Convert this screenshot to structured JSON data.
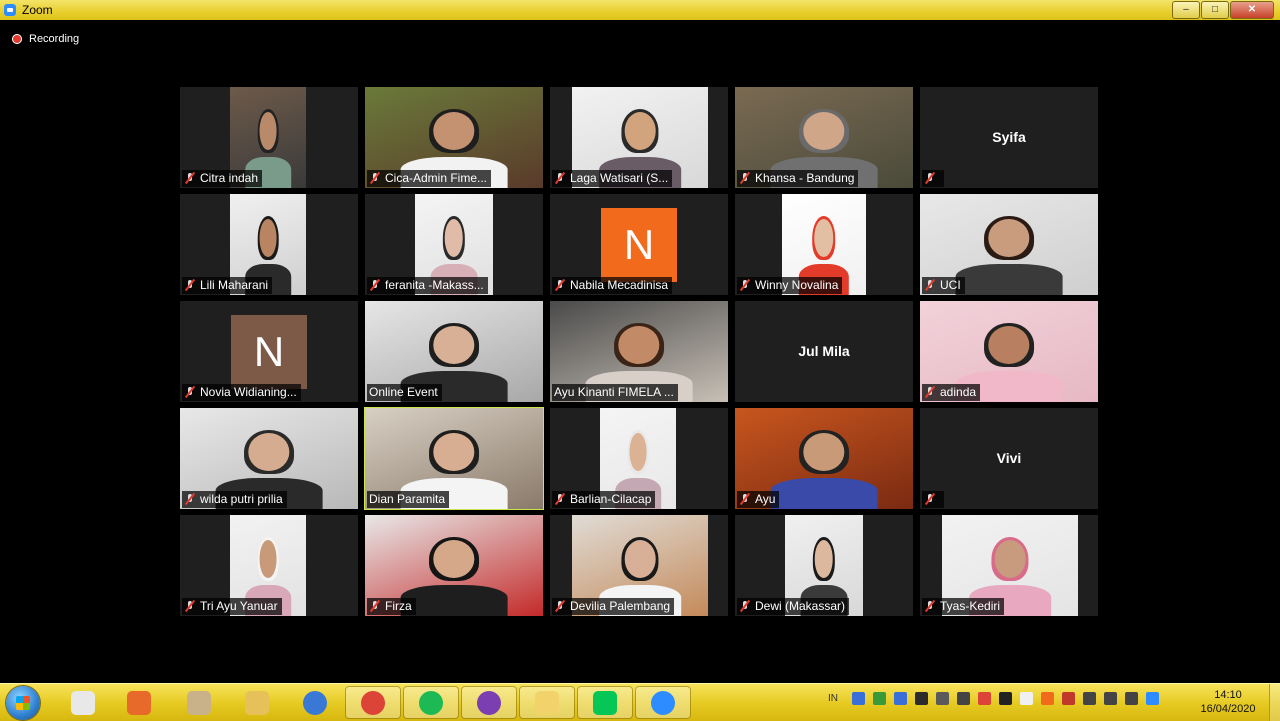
{
  "window": {
    "title": "Zoom",
    "controls": {
      "minimize": "–",
      "maximize": "□",
      "close": "✕"
    }
  },
  "recording": {
    "label": "Recording"
  },
  "participants": [
    {
      "name": "Citra indah",
      "type": "video",
      "muted": true
    },
    {
      "name": "Cica-Admin Fime...",
      "type": "video",
      "muted": true
    },
    {
      "name": "Laga Watisari (S...",
      "type": "video",
      "muted": true
    },
    {
      "name": "Khansa - Bandung",
      "type": "video",
      "muted": true
    },
    {
      "name": "",
      "display_name": "Syifa",
      "type": "name-only",
      "muted": true
    },
    {
      "name": "Lili Maharani",
      "type": "video",
      "muted": true
    },
    {
      "name": "feranita -Makass...",
      "type": "video",
      "muted": true
    },
    {
      "name": "Nabila Mecadinisa",
      "type": "avatar",
      "initial": "N",
      "avatar_color": "#f26b1d",
      "muted": true
    },
    {
      "name": "Winny Novalina",
      "type": "video",
      "muted": true
    },
    {
      "name": "UCI",
      "type": "video",
      "muted": true
    },
    {
      "name": "Novia Widianing...",
      "type": "avatar",
      "initial": "N",
      "avatar_color": "#7d5a48",
      "muted": true
    },
    {
      "name": "Online Event",
      "type": "video",
      "muted": false
    },
    {
      "name": "Ayu Kinanti FIMELA ...",
      "type": "video",
      "muted": false
    },
    {
      "name": "",
      "display_name": "Jul Mila",
      "type": "name-only",
      "muted": false
    },
    {
      "name": "adinda",
      "type": "video",
      "muted": true
    },
    {
      "name": "wilda putri prilia",
      "type": "video",
      "muted": true
    },
    {
      "name": "Dian Paramita",
      "type": "video",
      "muted": false,
      "active_speaker": true
    },
    {
      "name": "Barlian-Cilacap",
      "type": "video",
      "muted": true
    },
    {
      "name": "Ayu",
      "type": "video",
      "muted": true
    },
    {
      "name": "",
      "display_name": "Vivi",
      "type": "name-only",
      "muted": true
    },
    {
      "name": "Tri Ayu Yanuar",
      "type": "video",
      "muted": true
    },
    {
      "name": "Firza",
      "type": "video",
      "muted": true
    },
    {
      "name": "Devilia Palembang",
      "type": "video",
      "muted": true
    },
    {
      "name": "Dewi (Makassar)",
      "type": "video",
      "muted": true
    },
    {
      "name": "Tyas-Kediri",
      "type": "video",
      "muted": true
    }
  ],
  "taskbar": {
    "items": [
      {
        "icon": "tiles-app-icon",
        "color": "#e8e8e8",
        "running": false
      },
      {
        "icon": "media-player-icon",
        "color": "#e86a2a",
        "running": false
      },
      {
        "icon": "paint-icon",
        "color": "#c9b28a",
        "running": false
      },
      {
        "icon": "file-explorer-icon",
        "color": "#e6c15a",
        "running": false
      },
      {
        "icon": "chromium-icon",
        "color": "#3a78d6",
        "running": false
      },
      {
        "icon": "chrome-icon",
        "color": "#db4437",
        "running": true
      },
      {
        "icon": "spotify-icon",
        "color": "#1db954",
        "running": true
      },
      {
        "icon": "shield-app-icon",
        "color": "#7b3fb2",
        "running": true
      },
      {
        "icon": "folder-icon",
        "color": "#f2d36b",
        "running": true
      },
      {
        "icon": "line-icon",
        "color": "#06c755",
        "running": true
      },
      {
        "icon": "zoom-icon",
        "color": "#2d8cff",
        "running": true
      }
    ],
    "tray": {
      "language": "IN",
      "icons": [
        "#3a6fd8",
        "#3a9a3a",
        "#3a6fd8",
        "#2c2c2c",
        "#5a5a5a",
        "#444",
        "#db4437",
        "#222",
        "#f0f0f0",
        "#f26b1d",
        "#c0392b",
        "#444",
        "#444",
        "#444",
        "#2d8cff"
      ]
    },
    "clock": {
      "time": "14:10",
      "date": "16/04/2020"
    }
  }
}
